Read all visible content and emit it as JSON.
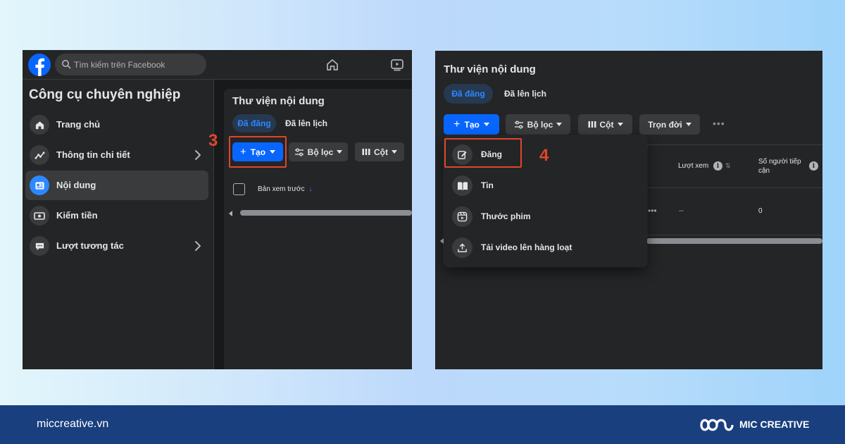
{
  "left": {
    "search_placeholder": "Tìm kiếm trên Facebook",
    "sidebar": {
      "title": "Công cụ chuyên nghiệp",
      "items": [
        {
          "label": "Trang chủ",
          "icon": "home-icon"
        },
        {
          "label": "Thông tin chi tiết",
          "icon": "trend-chart-icon"
        },
        {
          "label": "Nội dung",
          "icon": "content-icon"
        },
        {
          "label": "Kiếm tiền",
          "icon": "money-icon"
        },
        {
          "label": "Lượt tương tác",
          "icon": "chat-bubble-icon"
        }
      ]
    },
    "library": {
      "title": "Thư viện nội dung",
      "tab_published": "Đã đăng",
      "tab_scheduled": "Đã lên lịch",
      "create_label": "Tạo",
      "filter_label": "Bộ lọc",
      "column_label": "Cột",
      "preview_header": "Bản xem trước"
    },
    "step_number": "3"
  },
  "right": {
    "library": {
      "title": "Thư viện nội dung",
      "tab_published": "Đã đăng",
      "tab_scheduled": "Đã lên lịch",
      "create_label": "Tạo",
      "filter_label": "Bộ lọc",
      "column_label": "Cột",
      "lifetime_label": "Trọn đời"
    },
    "table": {
      "col_views": "Lượt xem",
      "col_reach": "Số người tiếp cận",
      "views_value": "--",
      "reach_value": "0"
    },
    "dropdown": [
      {
        "label": "Đăng",
        "icon": "edit-post-icon"
      },
      {
        "label": "Tin",
        "icon": "book-story-icon"
      },
      {
        "label": "Thước phim",
        "icon": "reel-icon"
      },
      {
        "label": "Tải video lên hàng loạt",
        "icon": "upload-icon"
      }
    ],
    "step_number": "4"
  },
  "footer": {
    "url": "miccreative.vn",
    "brand": "MIC CREATIVE"
  },
  "colors": {
    "accent_blue": "#0866ff",
    "highlight_red": "#e0452b",
    "footer_navy": "#1a3f7e",
    "dark_surface": "#242526"
  }
}
